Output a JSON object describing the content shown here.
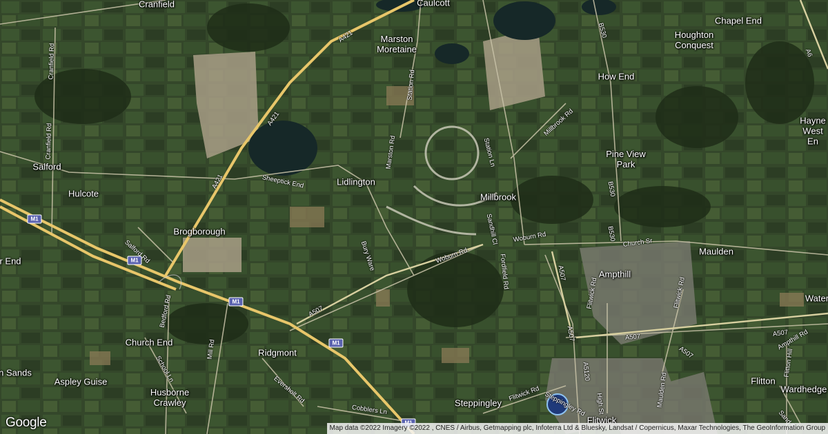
{
  "map": {
    "places": [
      {
        "id": "cranfield",
        "label": "Cranfield"
      },
      {
        "id": "caulcott",
        "label": "Caulcott"
      },
      {
        "id": "marston-moretaine",
        "label": "Marston\nMoretaine"
      },
      {
        "id": "chapel-end",
        "label": "Chapel End"
      },
      {
        "id": "houghton-conquest",
        "label": "Houghton\nConquest"
      },
      {
        "id": "how-end",
        "label": "How End"
      },
      {
        "id": "haynes-west-end",
        "label": "Hayne\nWest En"
      },
      {
        "id": "pine-view-park",
        "label": "Pine View\nPark"
      },
      {
        "id": "salford",
        "label": "Salford"
      },
      {
        "id": "lidlington",
        "label": "Lidlington"
      },
      {
        "id": "millbrook",
        "label": "Millbrook"
      },
      {
        "id": "hulcote",
        "label": "Hulcote"
      },
      {
        "id": "brogborough",
        "label": "Brogborough"
      },
      {
        "id": "maulden",
        "label": "Maulden"
      },
      {
        "id": "ampthill",
        "label": "Ampthill"
      },
      {
        "id": "r-end",
        "label": "r End"
      },
      {
        "id": "water",
        "label": "Water"
      },
      {
        "id": "church-end",
        "label": "Church End"
      },
      {
        "id": "ridgmont",
        "label": "Ridgmont"
      },
      {
        "id": "n-sands",
        "label": "n Sands"
      },
      {
        "id": "aspley-guise",
        "label": "Aspley Guise"
      },
      {
        "id": "husborne-crawley",
        "label": "Husborne\nCrawley"
      },
      {
        "id": "steppingley",
        "label": "Steppingley"
      },
      {
        "id": "flitton",
        "label": "Flitton"
      },
      {
        "id": "wardhedge",
        "label": "Wardhedge"
      },
      {
        "id": "flitwick",
        "label": "Flitwick"
      }
    ],
    "roads": [
      {
        "id": "a421-north",
        "label": "A421"
      },
      {
        "id": "a421-mid",
        "label": "A421"
      },
      {
        "id": "a421-south",
        "label": "A421"
      },
      {
        "id": "cranfield-rd-1",
        "label": "Cranfield Rd"
      },
      {
        "id": "cranfield-rd-2",
        "label": "Cranfield Rd"
      },
      {
        "id": "sheeptick-end",
        "label": "Sheeptick End"
      },
      {
        "id": "marston-rd",
        "label": "Marston Rd"
      },
      {
        "id": "station-rd",
        "label": "Station Rd"
      },
      {
        "id": "station-ln",
        "label": "Station Ln"
      },
      {
        "id": "millbrook-rd",
        "label": "Millbrook Rd"
      },
      {
        "id": "b530-north",
        "label": "B530"
      },
      {
        "id": "b530-mid",
        "label": "B530"
      },
      {
        "id": "b530-south",
        "label": "B530"
      },
      {
        "id": "sandhill-cl",
        "label": "Sandhill Cl"
      },
      {
        "id": "salford-rd",
        "label": "Salford Rd"
      },
      {
        "id": "bury-ware",
        "label": "Bury Ware"
      },
      {
        "id": "woburn-rd-1",
        "label": "Woburn Rd"
      },
      {
        "id": "woburn-rd-2",
        "label": "Woburn Rd"
      },
      {
        "id": "church-st",
        "label": "Church Sr"
      },
      {
        "id": "fordfield-rd",
        "label": "Fordfield Rd"
      },
      {
        "id": "a507-1",
        "label": "A507"
      },
      {
        "id": "a507-2",
        "label": "A507"
      },
      {
        "id": "a507-3",
        "label": "A507"
      },
      {
        "id": "a507-4",
        "label": "A507"
      },
      {
        "id": "a507-5",
        "label": "A507"
      },
      {
        "id": "a507-6",
        "label": "A507"
      },
      {
        "id": "flitwick-rd-1",
        "label": "Flitwick Rd"
      },
      {
        "id": "flitwick-rd-2",
        "label": "Flitwick Rd"
      },
      {
        "id": "flitwick-rd-3",
        "label": "Flitwick Rd"
      },
      {
        "id": "ampthill-rd",
        "label": "Ampthill Rd"
      },
      {
        "id": "bedford-rd",
        "label": "Bedford Rd"
      },
      {
        "id": "mill-rd",
        "label": "Mill Rd"
      },
      {
        "id": "school-ln",
        "label": "School Ln"
      },
      {
        "id": "eversholt-rd",
        "label": "Eversholt Rd"
      },
      {
        "id": "cobblers-ln",
        "label": "Cobblers Ln"
      },
      {
        "id": "a5120",
        "label": "A5120"
      },
      {
        "id": "high-st",
        "label": "High St"
      },
      {
        "id": "maulden-rd",
        "label": "Maulden Rd"
      },
      {
        "id": "flitton-hill",
        "label": "Flitton Hill"
      },
      {
        "id": "steppingley-rd",
        "label": "Steppingley Rd"
      },
      {
        "id": "sand-rd",
        "label": "Sand R"
      },
      {
        "id": "a6",
        "label": "A6"
      }
    ],
    "shields": [
      {
        "id": "m1-1",
        "label": "M1"
      },
      {
        "id": "m1-2",
        "label": "M1"
      },
      {
        "id": "m1-3",
        "label": "M1"
      },
      {
        "id": "m1-4",
        "label": "M1"
      },
      {
        "id": "m1-5",
        "label": "M1"
      }
    ],
    "logo": "Google",
    "attribution": "Map data ©2022 Imagery ©2022 , CNES / Airbus, Getmapping plc, Infoterra Ltd & Bluesky, Landsat / Copernicus, Maxar Technologies, The GeoInformation Group"
  },
  "colors": {
    "motorway": "#e8c66a",
    "road": "#c9c3a8",
    "marker_fill": "#1f3a7a",
    "marker_ring": "#8fc3f0"
  }
}
